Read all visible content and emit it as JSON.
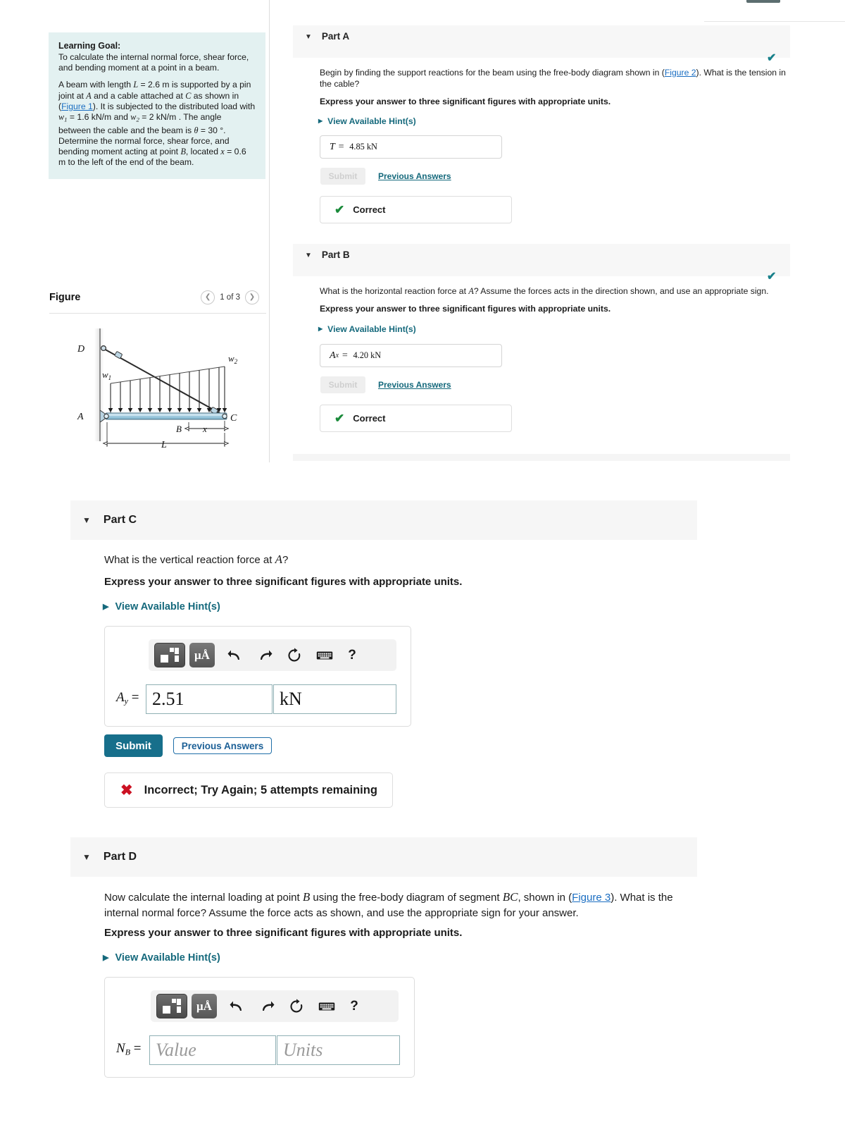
{
  "learning_goal": {
    "title": "Learning Goal:",
    "p1": "To calculate the internal normal force, shear force, and bending moment at a point in a beam.",
    "p2_a": "A beam with length ",
    "p2_L": "L",
    "p2_b": " = 2.6 m is supported by a pin joint at ",
    "p2_A": "A",
    "p2_c": " and a cable attached at ",
    "p2_C": "C",
    "p2_d": " as shown in (",
    "figure1_link": "Figure 1",
    "p2_e": "). It is subjected to the distributed load with ",
    "w1": "w",
    "w1_sub": "1",
    "p2_f": " = 1.6 kN/m and ",
    "w2": "w",
    "w2_sub": "2",
    "p2_g": " = 2 kN/m . The angle between the cable and the beam is ",
    "theta": "θ",
    "p2_h": " = 30 °. Determine the normal force, shear force, and bending moment acting at point ",
    "p2_B": "B",
    "p2_i": ", located ",
    "p2_x": "x",
    "p2_j": " = 0.6 m to the left of the end of the beam."
  },
  "figure": {
    "title": "Figure",
    "counter": "1 of 3",
    "prev_icon": "chevron-left-icon",
    "next_icon": "chevron-right-icon",
    "labels": {
      "D": "D",
      "A": "A",
      "B": "B",
      "C": "C",
      "L": "L",
      "x": "x",
      "w1": "w",
      "w1_sub": "1",
      "w2": "w",
      "w2_sub": "2"
    }
  },
  "parts": {
    "a": {
      "label": "Part A",
      "status_icon": "check-icon",
      "question_1": "Begin by finding the support reactions for the beam using the free-body diagram shown in (",
      "figure_link": "Figure 2",
      "question_2": "). What is the tension in the cable?",
      "instruction": "Express your answer to three significant figures with appropriate units.",
      "hints_label": "View Available Hint(s)",
      "answer_symbol": "T",
      "answer_eq": "=",
      "answer_value": "4.85 kN",
      "submit_label": "Submit",
      "previous_answers_label": "Previous Answers",
      "verdict": "Correct"
    },
    "b": {
      "label": "Part B",
      "status_icon": "check-icon",
      "question": "What is the horizontal reaction force at A? Assume the forces acts in the direction shown, and use an appropriate sign.",
      "question_pre": "What is the horizontal reaction force at ",
      "question_A": "A",
      "question_post": "? Assume the forces acts in the direction shown, and use an appropriate sign.",
      "instruction": "Express your answer to three significant figures with appropriate units.",
      "hints_label": "View Available Hint(s)",
      "answer_symbol": "A",
      "answer_symbol_sub": "x",
      "answer_eq": "=",
      "answer_value": "4.20 kN",
      "submit_label": "Submit",
      "previous_answers_label": "Previous Answers",
      "verdict": "Correct"
    },
    "c": {
      "label": "Part C",
      "question_pre": "What is the vertical reaction force at ",
      "question_A": "A",
      "question_post": "?",
      "instruction": "Express your answer to three significant figures with appropriate units.",
      "hints_label": "View Available Hint(s)",
      "field_symbol": "A",
      "field_symbol_sub": "y",
      "field_eq": "=",
      "value": "2.51",
      "units": "kN",
      "submit_label": "Submit",
      "previous_answers_label": "Previous Answers",
      "verdict": "Incorrect; Try Again; 5 attempts remaining",
      "verdict_icon": "x-icon"
    },
    "d": {
      "label": "Part D",
      "q_1": "Now calculate the internal loading at point ",
      "q_B": "B",
      "q_2": " using the free-body diagram of segment ",
      "q_BC": "BC",
      "q_3": ", shown in (",
      "figure_link": "Figure 3",
      "q_4": "). What is the internal normal force? Assume the force acts as shown, and use the appropriate sign for your answer.",
      "instruction": "Express your answer to three significant figures with appropriate units.",
      "hints_label": "View Available Hint(s)",
      "field_symbol": "N",
      "field_symbol_sub": "B",
      "field_eq": "=",
      "value_placeholder": "Value",
      "units_placeholder": "Units"
    }
  },
  "toolbar": {
    "template_icon": "math-template-icon",
    "units_label": "μÅ",
    "undo_icon": "undo-icon",
    "redo_icon": "redo-icon",
    "reset_icon": "reset-icon",
    "keyboard_icon": "keyboard-icon",
    "help_label": "?"
  },
  "colors": {
    "goal_bg": "#e3f1f1",
    "link": "#15697c",
    "submit": "#176f8b",
    "correct": "#1a8a3a",
    "incorrect": "#cc1122",
    "header_bg": "#f6f6f6"
  }
}
